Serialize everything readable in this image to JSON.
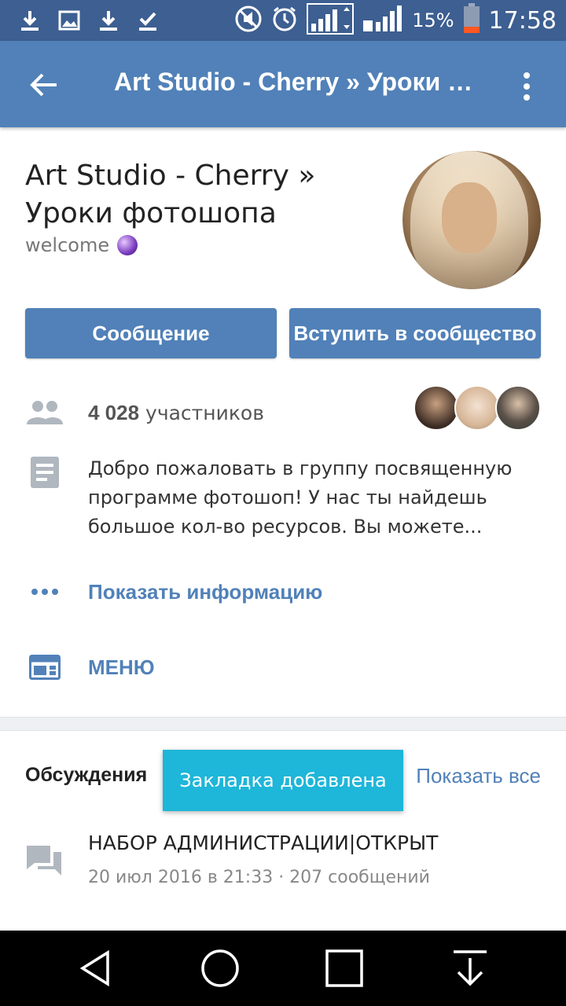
{
  "status_bar": {
    "battery_percent": "15%",
    "time": "17:58"
  },
  "app_bar": {
    "title": "Art Studio -  Cherry » Уроки фотошопа"
  },
  "group": {
    "name": "Art Studio -  Cherry » Уроки фотошопа",
    "status": "welcome"
  },
  "buttons": {
    "message": "Сообщение",
    "join": "Вступить в сообщество"
  },
  "members": {
    "count": "4 028",
    "label": "участников"
  },
  "description": "Добро пожаловать в группу посвященную программе фотошоп! У нас ты найдешь большое кол-во ресурсов. Вы можете...",
  "links": {
    "show_info": "Показать информацию",
    "menu": "МЕНЮ"
  },
  "discussions": {
    "title": "Обсуждения",
    "show_all": "Показать все",
    "topics": [
      {
        "title": "НАБОР АДМИНИСТРАЦИИ|ОТКРЫТ",
        "meta": "20 июл 2016 в 21:33 · 207 сообщений"
      }
    ]
  },
  "toast": {
    "text": "Закладка добавлена"
  },
  "colors": {
    "status_bar": "#3d5f91",
    "app_bar": "#5181b8",
    "accent": "#5181b8",
    "toast": "#1eb6d9",
    "battery_low": "#ff5722"
  }
}
